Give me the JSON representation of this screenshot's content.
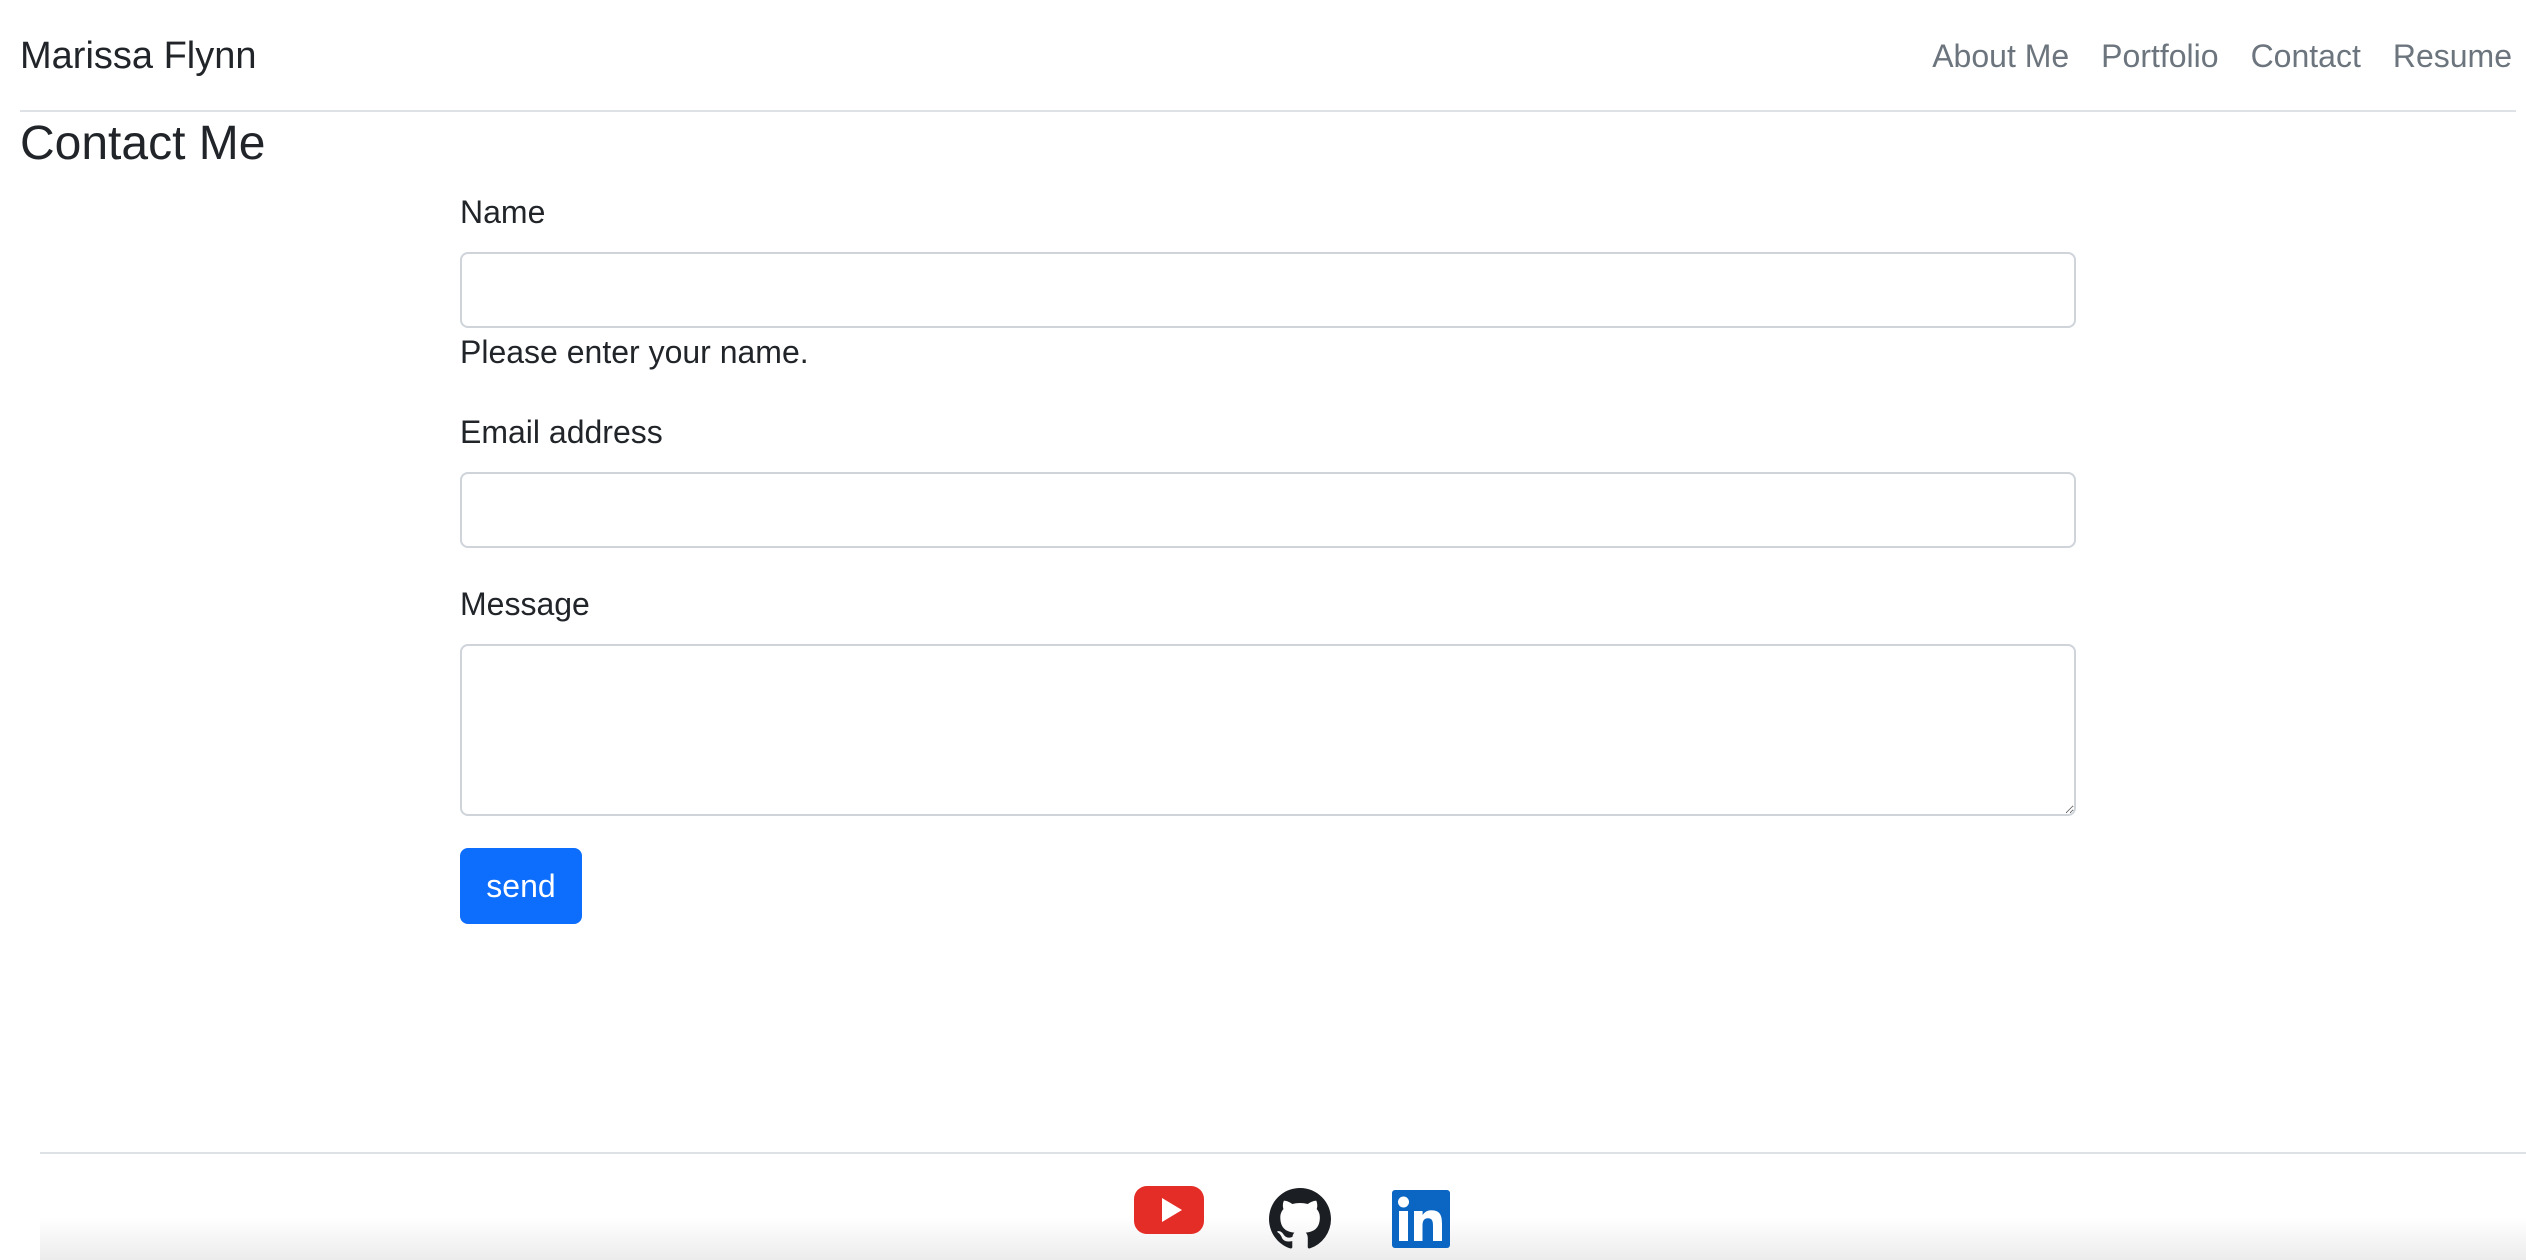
{
  "navbar": {
    "brand": "Marissa Flynn",
    "links": [
      "About Me",
      "Portfolio",
      "Contact",
      "Resume"
    ]
  },
  "page": {
    "heading": "Contact Me"
  },
  "form": {
    "name": {
      "label": "Name",
      "value": "",
      "error": "Please enter your name."
    },
    "email": {
      "label": "Email address",
      "value": ""
    },
    "message": {
      "label": "Message",
      "value": ""
    },
    "send_label": "send"
  },
  "footer": {
    "icons": [
      "youtube-icon",
      "github-icon",
      "linkedin-icon"
    ]
  },
  "colors": {
    "primary": "#0d6efd",
    "nav_link": "#6c757d",
    "text": "#212529",
    "youtube": "#e52d27",
    "linkedin": "#0a66c2"
  }
}
